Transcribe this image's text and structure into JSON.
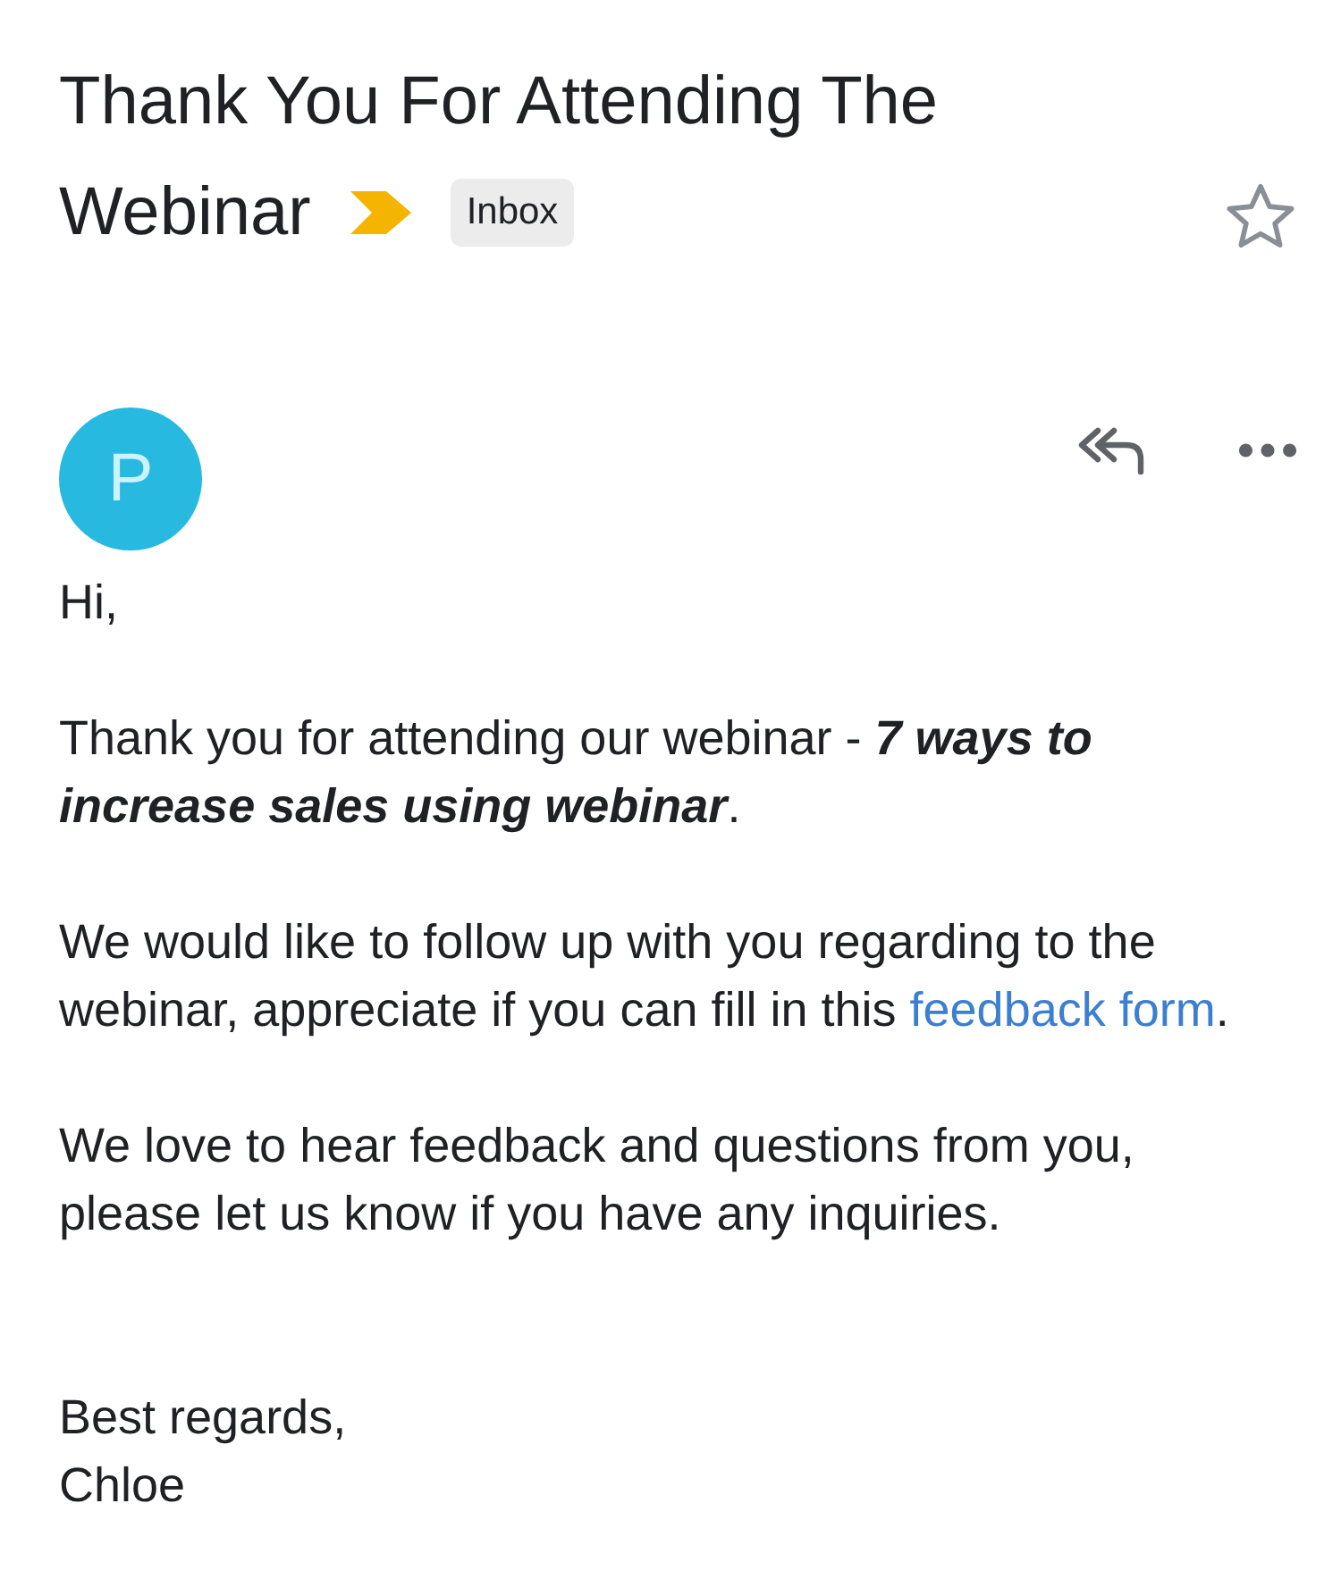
{
  "subject_lines": [
    "Thank You For Attending The",
    "Webinar"
  ],
  "important": true,
  "label": "Inbox",
  "starred": false,
  "sender": {
    "initial": "P",
    "color": "#27b9df"
  },
  "body": [
    {
      "parts": [
        {
          "kind": "text",
          "text": "Hi,"
        }
      ]
    },
    {
      "parts": [
        {
          "kind": "text",
          "text": "Thank you for attending our webinar - "
        },
        {
          "kind": "emphasis",
          "text": "7 ways to increase sales using webinar"
        },
        {
          "kind": "text",
          "text": "."
        }
      ]
    },
    {
      "parts": [
        {
          "kind": "text",
          "text": "We would like to follow up with you regarding to the webinar, appreciate if you can fill in this "
        },
        {
          "kind": "link",
          "text": "feedback form"
        },
        {
          "kind": "text",
          "text": "."
        }
      ]
    },
    {
      "parts": [
        {
          "kind": "text",
          "text": "We love to hear feedback and questions from you, please let us know if you have any inquiries."
        }
      ]
    }
  ],
  "signature": [
    "Best regards,",
    "Chloe"
  ]
}
